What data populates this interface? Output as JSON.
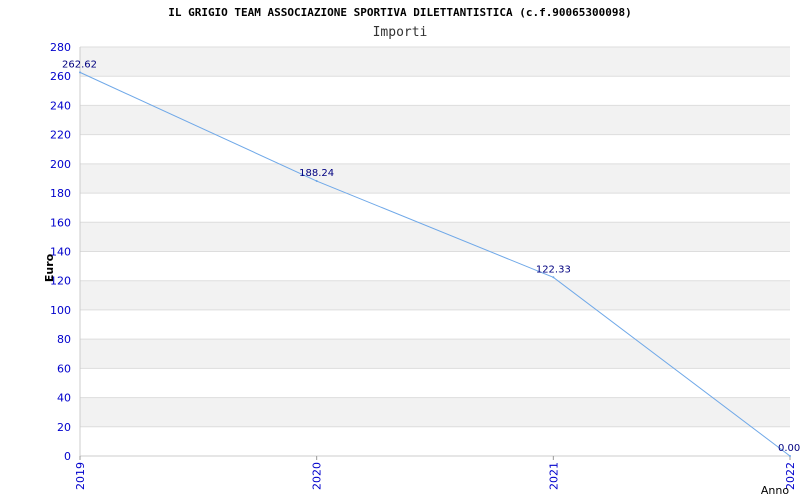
{
  "chart_data": {
    "type": "line",
    "title": "IL GRIGIO TEAM ASSOCIAZIONE SPORTIVA DILETTANTISTICA (c.f.90065300098)",
    "subtitle": "Importi",
    "xlabel": "Anno",
    "ylabel": "Euro",
    "categories": [
      "2019",
      "2020",
      "2021",
      "2022"
    ],
    "series": [
      {
        "values": [
          262.62,
          188.24,
          122.33,
          0.0
        ],
        "labels": [
          "262.62",
          "188.24",
          "122.33",
          "0.00"
        ]
      }
    ],
    "ylim": [
      0,
      280
    ],
    "yticks": [
      "0",
      "20",
      "40",
      "60",
      "80",
      "100",
      "120",
      "140",
      "160",
      "180",
      "200",
      "220",
      "240",
      "260",
      "280"
    ],
    "grid": true,
    "colors": {
      "line": "#6fa8e8",
      "tick_label": "#0000cc",
      "data_label": "#000080",
      "band": "#f2f2f2",
      "grid": "#dddddd"
    }
  }
}
